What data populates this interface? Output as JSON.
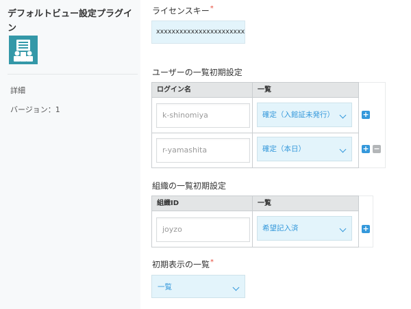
{
  "sidebar": {
    "plugin_title": "デフォルトビュー設定プラグイン",
    "logo_icon": "plugin-logo-icon",
    "detail_link": "詳細",
    "version": "バージョン：1"
  },
  "license": {
    "label": "ライセンスキー",
    "required_mark": "*",
    "value": "xxxxxxxxxxxxxxxxxxxxxxxx"
  },
  "user_defaults": {
    "label": "ユーザーの一覧初期設定",
    "columns": [
      "ログイン名",
      "一覧"
    ],
    "rows": [
      {
        "login": "k-shinomiya",
        "view": "確定（入館証未発行）"
      },
      {
        "login": "r-yamashita",
        "view": "確定（本日）"
      }
    ]
  },
  "org_defaults": {
    "label": "組織の一覧初期設定",
    "columns": [
      "組織ID",
      "一覧"
    ],
    "rows": [
      {
        "org_id": "joyzo",
        "view": "希望記入済"
      }
    ]
  },
  "initial_view": {
    "label": "初期表示の一覧",
    "required_mark": "*",
    "value": "一覧"
  },
  "buttons": {
    "add": "+",
    "remove": "−"
  },
  "colors": {
    "accent": "#3498db",
    "select_bg": "#e3f4fb",
    "logo": "#3498a8",
    "required": "#e74c3c"
  }
}
